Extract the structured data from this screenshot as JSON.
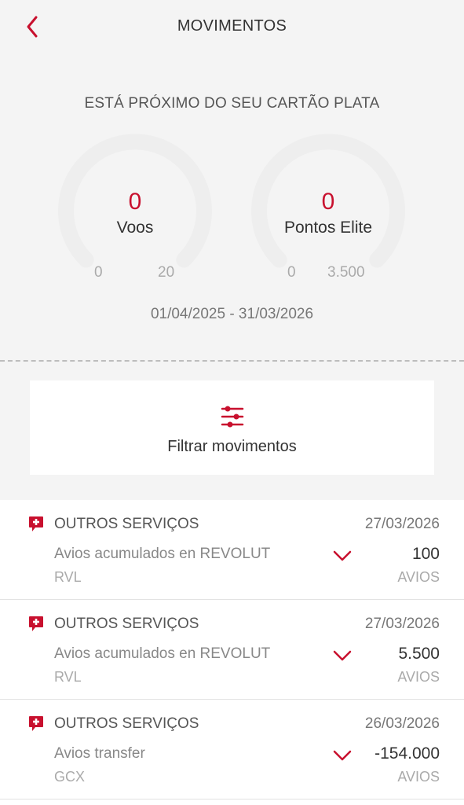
{
  "header": {
    "title": "MOVIMENTOS",
    "back_icon": "chevron-left-icon"
  },
  "status": {
    "subtitle": "ESTÁ PRÓXIMO DO SEU CARTÃO PLATA"
  },
  "gauges": [
    {
      "value": "0",
      "label": "Voos",
      "min": "0",
      "max": "20",
      "progress": 0
    },
    {
      "value": "0",
      "label": "Pontos Elite",
      "min": "0",
      "max": "3.500",
      "progress": 0
    }
  ],
  "period": "01/04/2025 - 31/03/2026",
  "filter": {
    "label": "Filtrar movimentos",
    "icon": "sliders-icon"
  },
  "movements": [
    {
      "category": "OUTROS SERVIÇOS",
      "date": "27/03/2026",
      "description": "Avios acumulados en REVOLUT",
      "code": "RVL",
      "amount": "100",
      "unit": "AVIOS"
    },
    {
      "category": "OUTROS SERVIÇOS",
      "date": "27/03/2026",
      "description": "Avios acumulados en REVOLUT",
      "code": "RVL",
      "amount": "5.500",
      "unit": "AVIOS"
    },
    {
      "category": "OUTROS SERVIÇOS",
      "date": "26/03/2026",
      "description": "Avios transfer",
      "code": "GCX",
      "amount": "-154.000",
      "unit": "AVIOS"
    }
  ],
  "colors": {
    "accent": "#c8102e",
    "track": "#eeeeee",
    "background": "#f4f4f4"
  }
}
